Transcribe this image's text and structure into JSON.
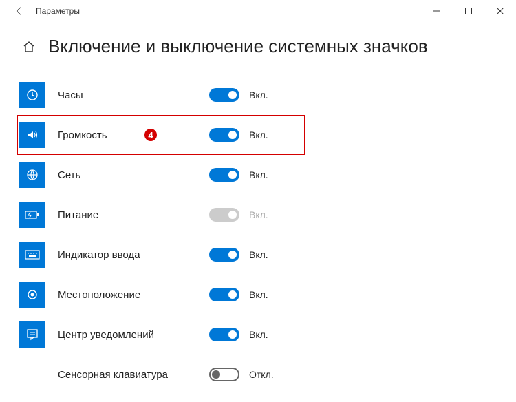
{
  "window": {
    "title": "Параметры"
  },
  "page": {
    "title": "Включение и выключение системных значков"
  },
  "annotation": {
    "number": "4"
  },
  "items": [
    {
      "label": "Часы",
      "state": "Вкл.",
      "toggle": "on",
      "icon": "clock"
    },
    {
      "label": "Громкость",
      "state": "Вкл.",
      "toggle": "on",
      "icon": "volume",
      "highlight": true
    },
    {
      "label": "Сеть",
      "state": "Вкл.",
      "toggle": "on",
      "icon": "globe"
    },
    {
      "label": "Питание",
      "state": "Вкл.",
      "toggle": "disabled",
      "icon": "battery"
    },
    {
      "label": "Индикатор ввода",
      "state": "Вкл.",
      "toggle": "on",
      "icon": "keyboard"
    },
    {
      "label": "Местоположение",
      "state": "Вкл.",
      "toggle": "on",
      "icon": "location"
    },
    {
      "label": "Центр уведомлений",
      "state": "Вкл.",
      "toggle": "on",
      "icon": "action-center"
    },
    {
      "label": "Сенсорная клавиатура",
      "state": "Откл.",
      "toggle": "off",
      "icon": "touch-keyboard"
    }
  ]
}
